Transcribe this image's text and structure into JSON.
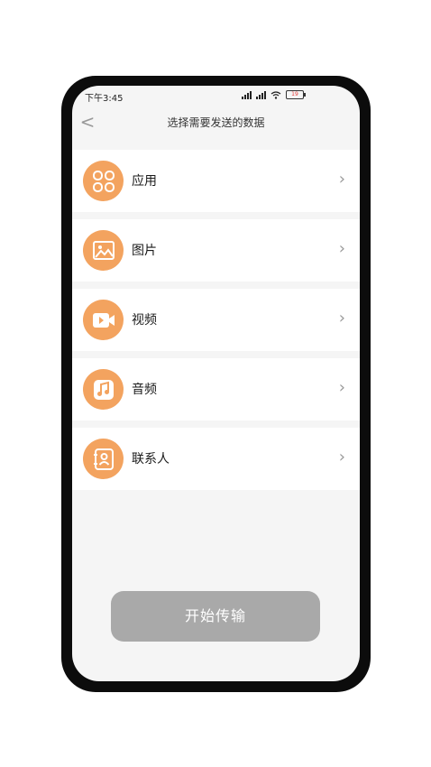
{
  "status_bar": {
    "time": "下午3:45",
    "battery": "19"
  },
  "header": {
    "back_symbol": "<",
    "title": "选择需要发送的数据"
  },
  "items": [
    {
      "label": "应用",
      "icon": "apps-grid-icon"
    },
    {
      "label": "图片",
      "icon": "image-icon"
    },
    {
      "label": "视频",
      "icon": "video-icon"
    },
    {
      "label": "音频",
      "icon": "music-note-icon"
    },
    {
      "label": "联系人",
      "icon": "contact-book-icon"
    }
  ],
  "chevron": "›",
  "start_button": {
    "label": "开始传输"
  },
  "colors": {
    "accent": "#f3a35f",
    "button_disabled": "#a9a9a9",
    "background": "#f5f5f5"
  }
}
